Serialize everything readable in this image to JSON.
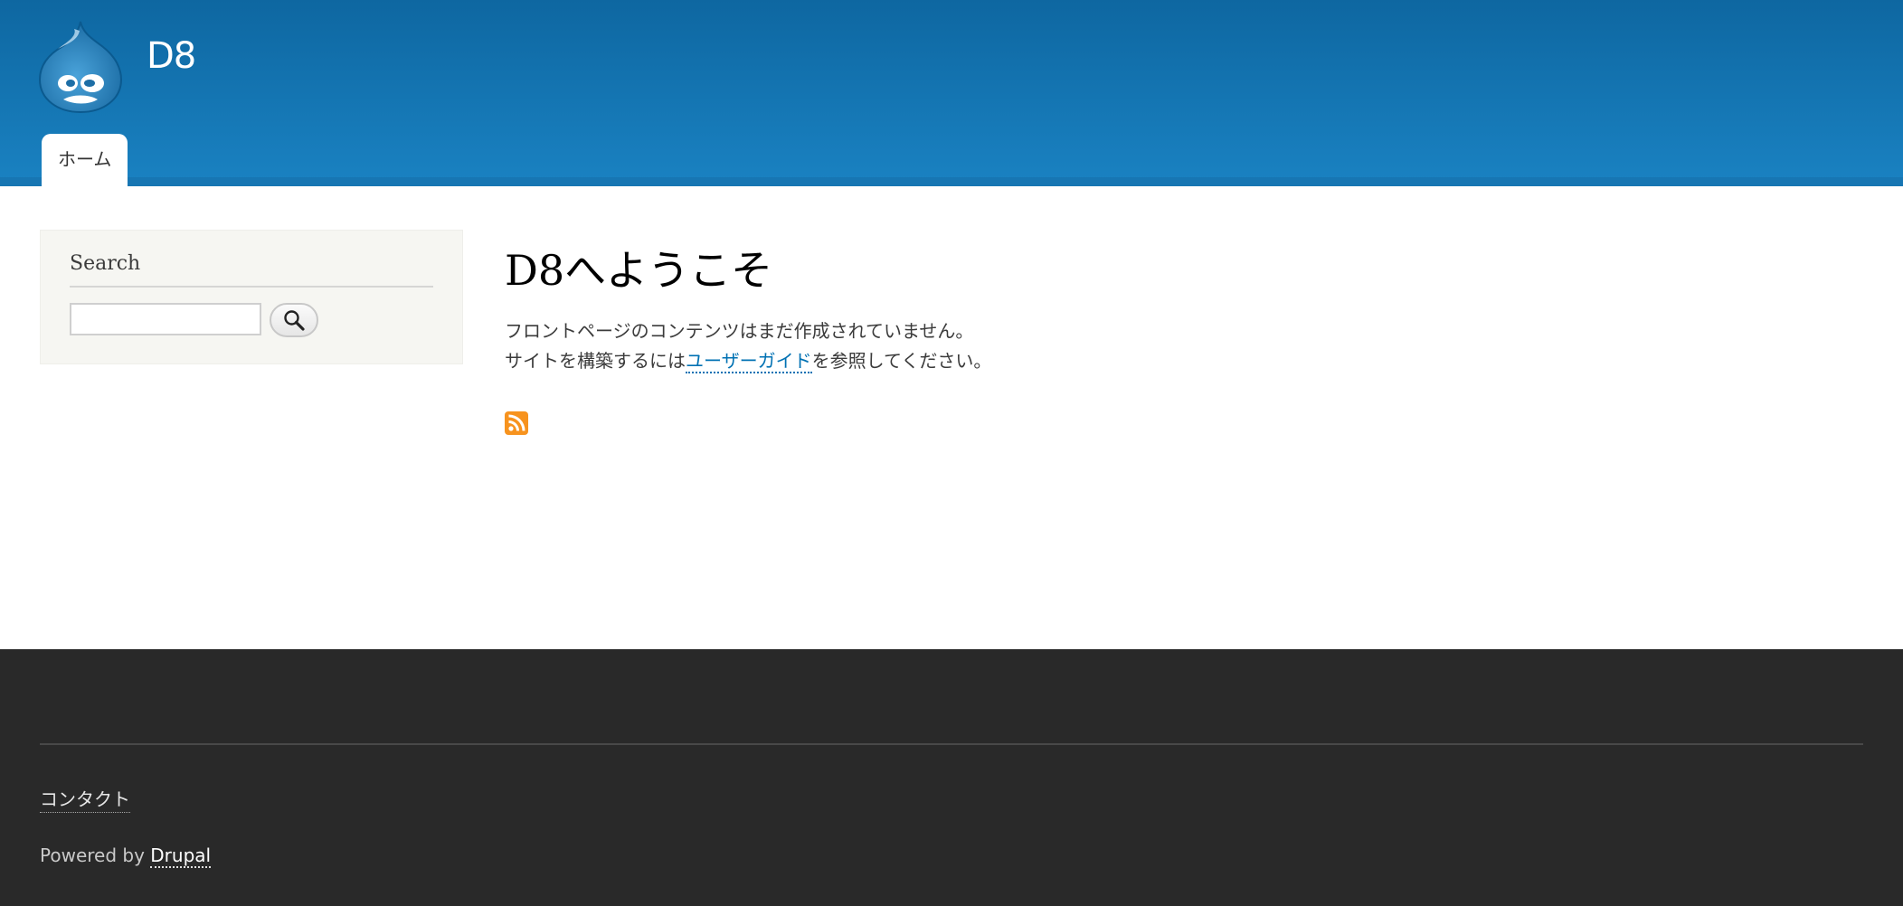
{
  "header": {
    "site_name": "D8",
    "logo_icon": "drupal-drop-icon",
    "colors": {
      "background_top": "#0e67a1",
      "background_bottom": "#1a82c2"
    },
    "menu": {
      "items": [
        {
          "label": "ホーム",
          "active": true
        }
      ]
    }
  },
  "sidebar": {
    "search_block": {
      "title": "Search",
      "input_value": "",
      "button_icon": "search-icon"
    }
  },
  "main": {
    "title": "D8へようこそ",
    "line1": "フロントページのコンテンツはまだ作成されていません。",
    "line2_before": "サイトを構築するには",
    "line2_link": "ユーザーガイド",
    "line2_after": "を参照してください。",
    "feed_icon": "rss-icon",
    "colors": {
      "link": "#0071b3",
      "feed": "#f7931e"
    }
  },
  "footer": {
    "contact_label": "コンタクト",
    "powered_by": "Powered by ",
    "drupal_label": "Drupal",
    "colors": {
      "background": "#292929"
    }
  }
}
